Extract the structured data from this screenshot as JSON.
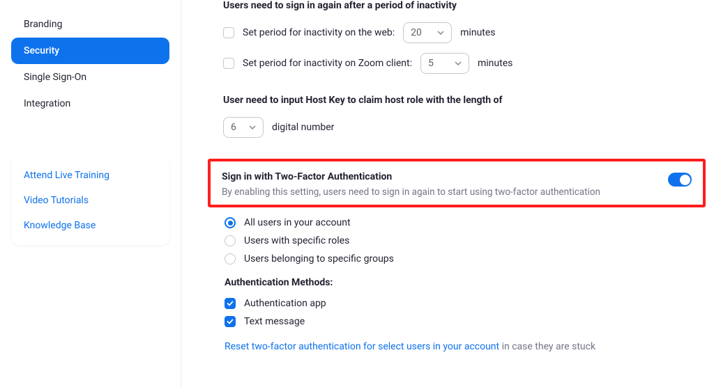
{
  "sidebar": {
    "items": [
      {
        "label": "Branding",
        "key": "branding"
      },
      {
        "label": "Security",
        "key": "security"
      },
      {
        "label": "Single Sign-On",
        "key": "sso"
      },
      {
        "label": "Integration",
        "key": "integration"
      }
    ],
    "active_index": 1,
    "help": [
      {
        "label": "Attend Live Training"
      },
      {
        "label": "Video Tutorials"
      },
      {
        "label": "Knowledge Base"
      }
    ]
  },
  "inactivity": {
    "title": "Users need to sign in again after a period of inactivity",
    "web": {
      "label": "Set period for inactivity on the web:",
      "value": "20",
      "unit": "minutes",
      "checked": false
    },
    "client": {
      "label": "Set period for inactivity on Zoom client:",
      "value": "5",
      "unit": "minutes",
      "checked": false
    }
  },
  "hostkey": {
    "title": "User need to input Host Key to claim host role with the length of",
    "value": "6",
    "unit": "digital number"
  },
  "twofa": {
    "title": "Sign in with Two-Factor Authentication",
    "desc": "By enabling this setting, users need to sign in again to start using two-factor authentication",
    "enabled": true,
    "scope_options": [
      "All users in your account",
      "Users with specific roles",
      "Users belonging to specific groups"
    ],
    "scope_selected_index": 0,
    "auth_methods_title": "Authentication Methods:",
    "methods": [
      {
        "label": "Authentication app",
        "checked": true
      },
      {
        "label": "Text message",
        "checked": true
      }
    ],
    "reset_link": "Reset two-factor authentication for select users in your account",
    "reset_suffix": " in case they are stuck"
  }
}
